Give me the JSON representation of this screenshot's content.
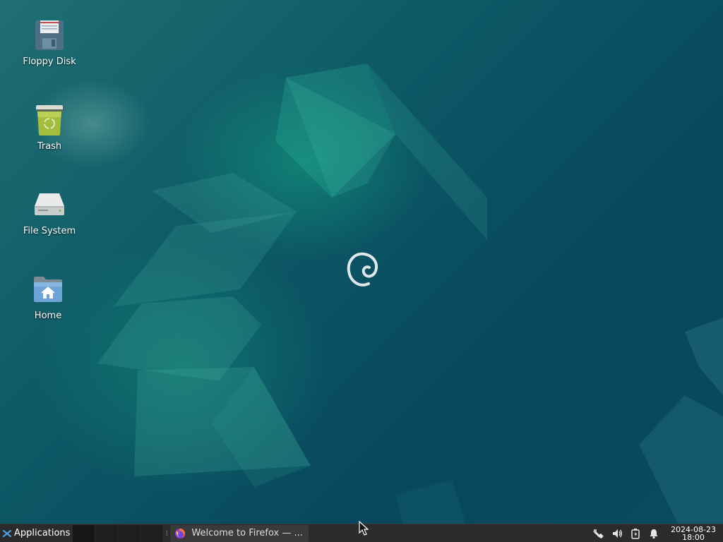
{
  "desktop": {
    "icons": [
      {
        "label": "Floppy Disk",
        "icon": "floppy-disk-icon"
      },
      {
        "label": "Trash",
        "icon": "trash-icon"
      },
      {
        "label": "File System",
        "icon": "hard-drive-icon"
      },
      {
        "label": "Home",
        "icon": "home-folder-icon"
      }
    ],
    "logo": "debian-swirl-logo"
  },
  "taskbar": {
    "applications_label": "Applications",
    "applications_icon": "xfce-menu-icon",
    "workspaces": 4,
    "window_buttons": [
      {
        "label": "Welcome to Firefox — ...",
        "icon": "firefox-icon"
      }
    ],
    "tray_icons": [
      "network-wired-icon",
      "volume-icon",
      "battery-charging-icon",
      "notification-bell-icon"
    ],
    "clock": {
      "date": "2024-08-23",
      "time": "18:00"
    }
  },
  "colors": {
    "desktop_bg": "#0d5a66",
    "taskbar_bg": "#2b2b2b",
    "accent": "#1aa88a"
  }
}
